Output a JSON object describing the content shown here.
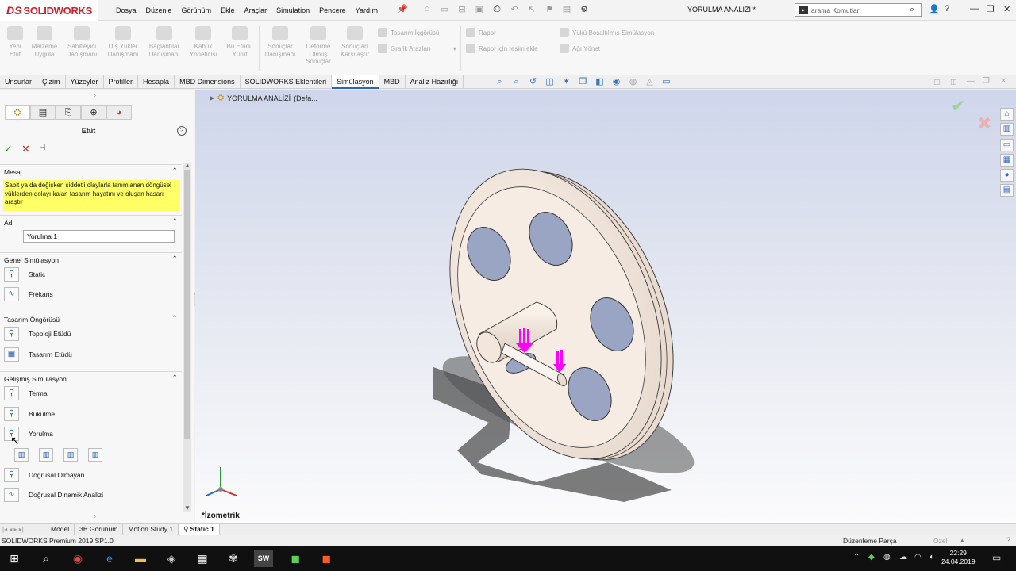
{
  "app": {
    "logo_ds": "DS",
    "logo_name": "SOLIDWORKS",
    "document_title": "YORULMA ANALİZİ *",
    "menu": [
      "Dosya",
      "Düzenle",
      "Görünüm",
      "Ekle",
      "Araçlar",
      "Simulation",
      "Pencere",
      "Yardım"
    ],
    "search_placeholder": "arama Komutları"
  },
  "ribbon": {
    "buttons": [
      {
        "label": "Yeni\nEtüt"
      },
      {
        "label": "Malzeme\nUygula"
      },
      {
        "label": "Sabitleyici\nDanışmanı"
      },
      {
        "label": "Dış Yükler\nDanışmanı"
      },
      {
        "label": "Bağlantılar\nDanışmanı"
      },
      {
        "label": "Kabuk\nYöneticisi"
      },
      {
        "label": "Bu Etüdü\nYürüt"
      },
      {
        "label": "Sonuçlar\nDanışmanı"
      },
      {
        "label": "Deforme\nOlmuş\nSonuçlar"
      },
      {
        "label": "Sonuçları\nKarşılaştır"
      }
    ],
    "small": {
      "design_insight": "Tasarım İçgörüsü",
      "graph_results": "Grafik Arazları",
      "report": "Rapor",
      "report_image": "Rapor için resim ekle",
      "load_sim": "Yükü Boşaltılmış Simülasyon",
      "mesh_network": "Ağı Yönet"
    }
  },
  "tabs": [
    "Unsurlar",
    "Çizim",
    "Yüzeyler",
    "Profiller",
    "Hesapla",
    "MBD Dimensions",
    "SOLIDWORKS Eklentileri",
    "Simülasyon",
    "MBD",
    "Analiz Hazırlığı"
  ],
  "active_tab": "Simülasyon",
  "property_manager": {
    "title": "Etüt",
    "groups": {
      "message": {
        "header": "Mesaj",
        "text": "Sabit ya da değişken şiddetli olaylarla tanımlanan döngüsel yüklerden dolayı kalan tasarım hayatını ve oluşan hasarı araştır"
      },
      "name": {
        "header": "Ad",
        "value": "Yorulma 1"
      },
      "general": {
        "header": "Genel Simülasyon",
        "items": [
          "Static",
          "Frekans"
        ]
      },
      "design_insight": {
        "header": "Tasarım Öngörüsü",
        "items": [
          "Topoloji Etüdü",
          "Tasarım Etüdü"
        ]
      },
      "advanced": {
        "header": "Gelişmiş Simülasyon",
        "items": [
          "Termal",
          "Bükülme",
          "Yorulma",
          "Doğrusal Olmayan",
          "Doğrusal Dinamik Analizi"
        ]
      }
    }
  },
  "viewport": {
    "tree_root": "YORULMA ANALİZİ",
    "tree_root_config": "(Defa...",
    "view_orientation": "*İzometrik"
  },
  "bottom_tabs": [
    "Model",
    "3B Görünüm",
    "Motion Study 1",
    "Static 1"
  ],
  "active_bottom_tab": "Static 1",
  "status": {
    "version": "SOLIDWORKS Premium 2019 SP1.0",
    "mode": "Düzenleme Parça",
    "custom": "Özel"
  },
  "taskbar": {
    "time": "22:29",
    "date": "24.04.2019"
  },
  "colors": {
    "accent": "#2b63c6",
    "brand": "#d0202a",
    "message_bg": "#ffff66",
    "load_arrow": "#ff00ff"
  }
}
